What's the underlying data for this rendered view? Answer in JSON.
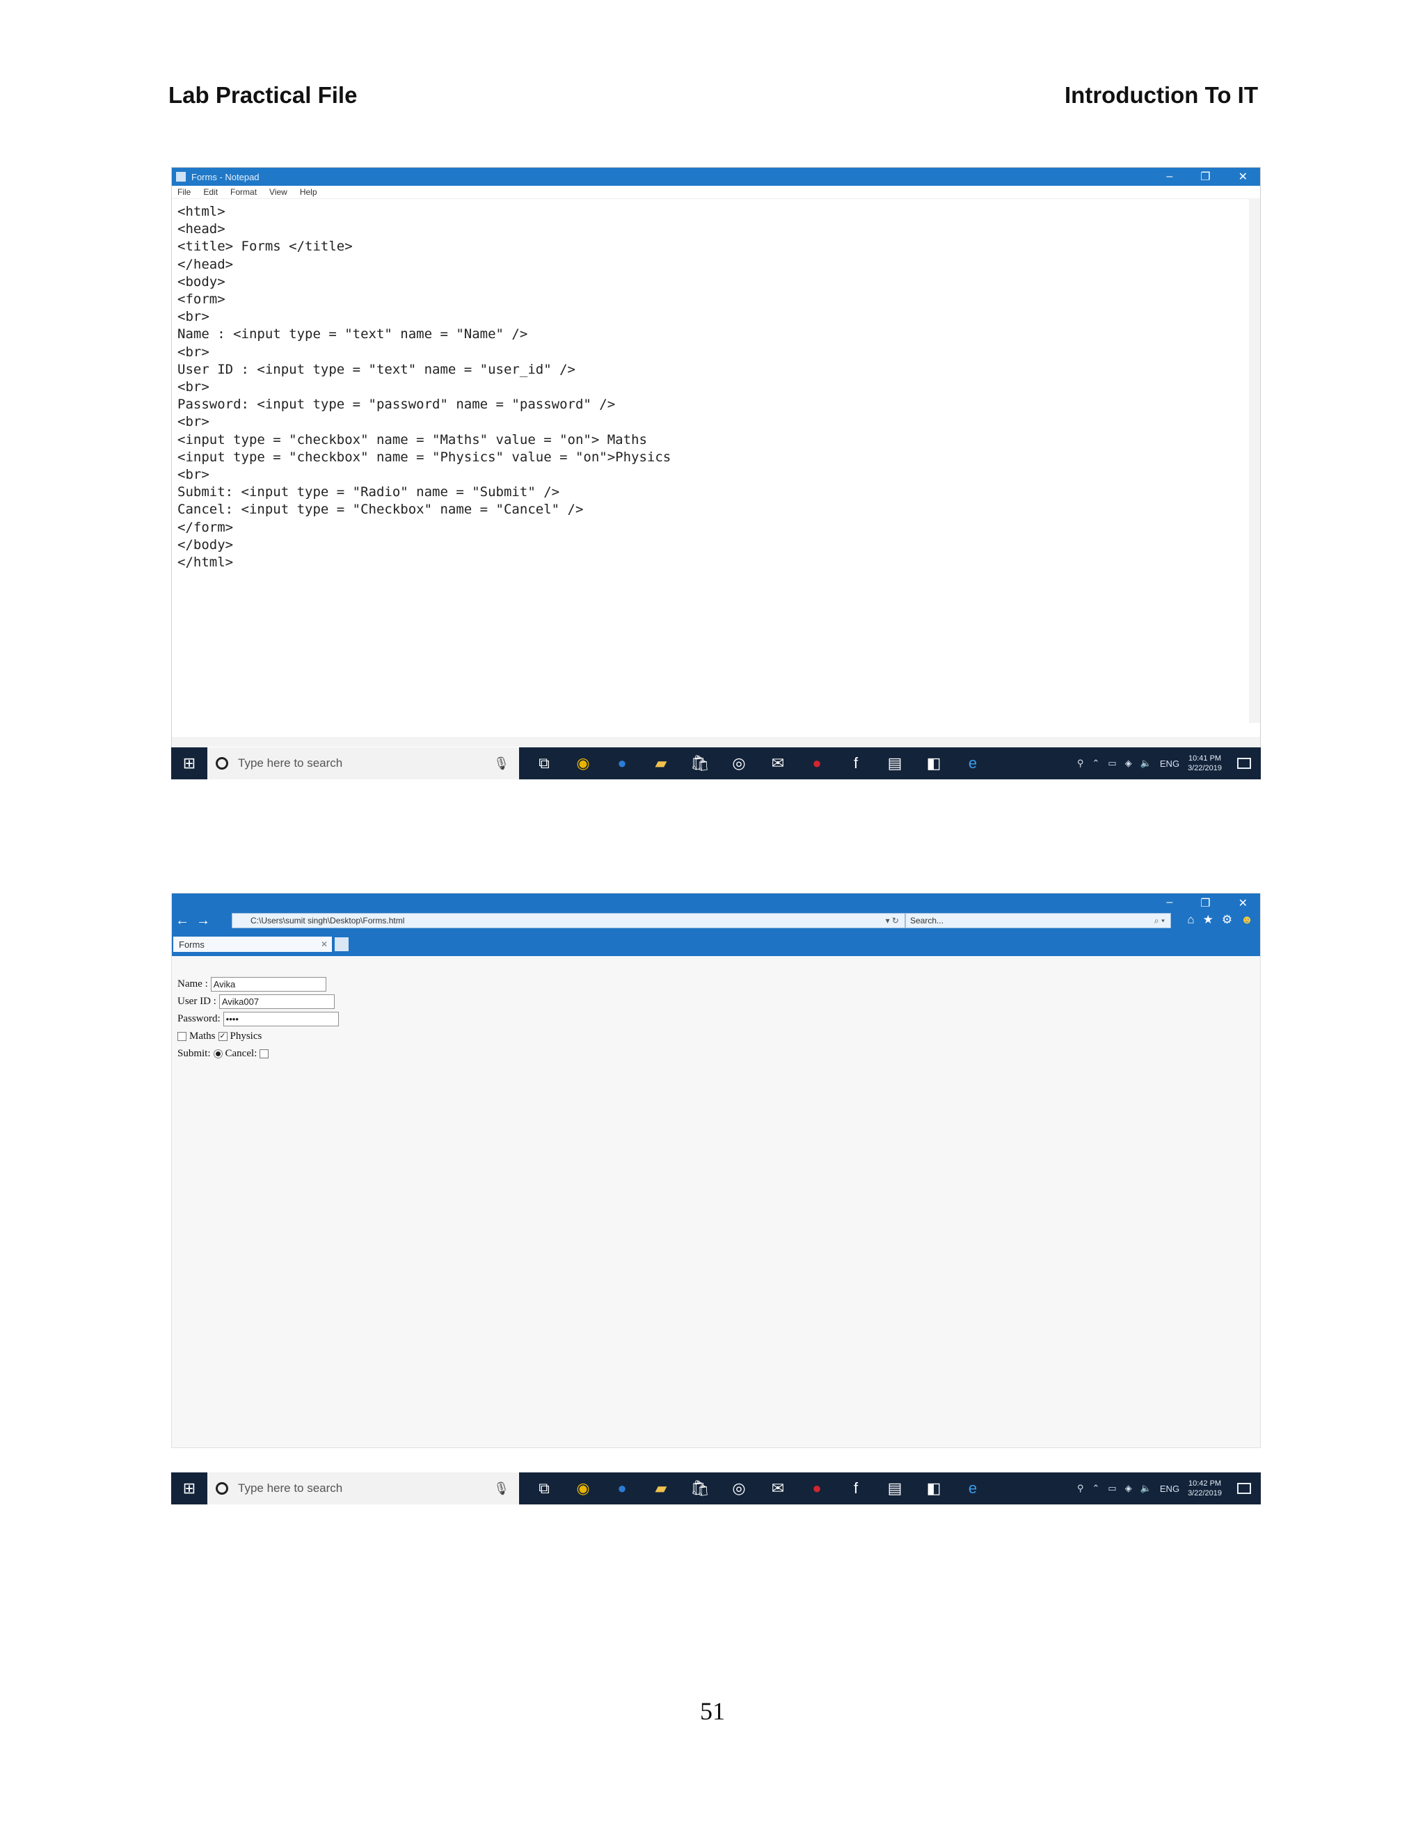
{
  "header": {
    "left": "Lab Practical File",
    "right": "Introduction To IT"
  },
  "notepad": {
    "title": "Forms - Notepad",
    "menu": [
      "File",
      "Edit",
      "Format",
      "View",
      "Help"
    ],
    "code": [
      "<html>",
      "<head>",
      "<title> Forms </title>",
      "</head>",
      "<body>",
      "<form>",
      "<br>",
      "Name : <input type = \"text\" name = \"Name\" />",
      "<br>",
      "User ID : <input type = \"text\" name = \"user_id\" />",
      "<br>",
      "Password: <input type = \"password\" name = \"password\" />",
      "<br>",
      "<input type = \"checkbox\" name = \"Maths\" value = \"on\"> Maths",
      "<input type = \"checkbox\" name = \"Physics\" value = \"on\">Physics",
      "<br>",
      "Submit: <input type = \"Radio\" name = \"Submit\" />",
      "Cancel: <input type = \"Checkbox\" name = \"Cancel\" />",
      "</form>",
      "</body>",
      "</html>"
    ]
  },
  "taskbar1": {
    "search_placeholder": "Type here to search",
    "lang": "ENG",
    "time": "10:41 PM",
    "date": "3/22/2019"
  },
  "browser": {
    "address": "C:\\Users\\sumit singh\\Desktop\\Forms.html",
    "search_placeholder": "Search...",
    "tab_title": "Forms",
    "form": {
      "name_label": "Name :",
      "name_value": "Avika",
      "userid_label": "User ID :",
      "userid_value": "Avika007",
      "password_label": "Password:",
      "password_value": "••••",
      "maths_label": "Maths",
      "maths_checked": false,
      "physics_label": "Physics",
      "physics_checked": true,
      "submit_label": "Submit:",
      "submit_selected": true,
      "cancel_label": "Cancel:",
      "cancel_checked": false
    }
  },
  "taskbar2": {
    "search_placeholder": "Type here to search",
    "lang": "ENG",
    "time": "10:42 PM",
    "date": "3/22/2019"
  },
  "page_number": "51"
}
